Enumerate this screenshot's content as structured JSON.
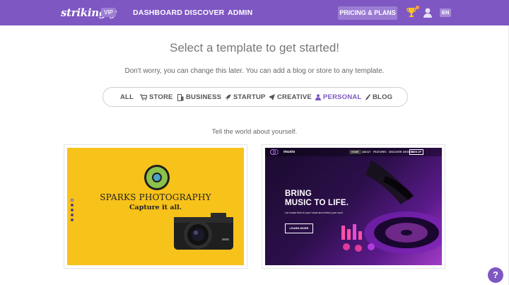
{
  "nav": {
    "logo": "strikingly",
    "vip": "VIP",
    "links": [
      "DASHBOARD",
      "DISCOVER",
      "ADMIN"
    ],
    "pricing": "PRICING & PLANS",
    "lang": "EN"
  },
  "page": {
    "title": "Select a template to get started!",
    "subtitle": "Don't worry, you can change this later. You can add a blog or store to any template.",
    "section_text": "Tell the world about yourself."
  },
  "filters": [
    {
      "label": "ALL",
      "icon": "none",
      "active": false
    },
    {
      "label": "STORE",
      "icon": "cart-icon",
      "active": false
    },
    {
      "label": "BUSINESS",
      "icon": "building-icon",
      "active": false
    },
    {
      "label": "STARTUP",
      "icon": "rocket-icon",
      "active": false
    },
    {
      "label": "CREATIVE",
      "icon": "paper-plane-icon",
      "active": false
    },
    {
      "label": "PERSONAL",
      "icon": "person-icon",
      "active": true
    },
    {
      "label": "BLOG",
      "icon": "pen-icon",
      "active": false
    }
  ],
  "templates": [
    {
      "title": "SPARKS PHOTOGRAPHY",
      "tagline": "Capture it all."
    },
    {
      "logo": "musio",
      "menu": [
        "HOME",
        "ABOUT",
        "FEATURES",
        "DISCOVER",
        "DEVICES"
      ],
      "signup": "SIGN UP",
      "headline_1": "BRING",
      "headline_2": "MUSIC TO LIFE.",
      "body": "Let music flow in your heart and enrich your soul.",
      "button": "LEARN MORE"
    }
  ],
  "help": "?",
  "colors": {
    "brand": "#7e57c2",
    "active_filter": "#7e57c2",
    "sparks_bg": "#f7c21a"
  }
}
